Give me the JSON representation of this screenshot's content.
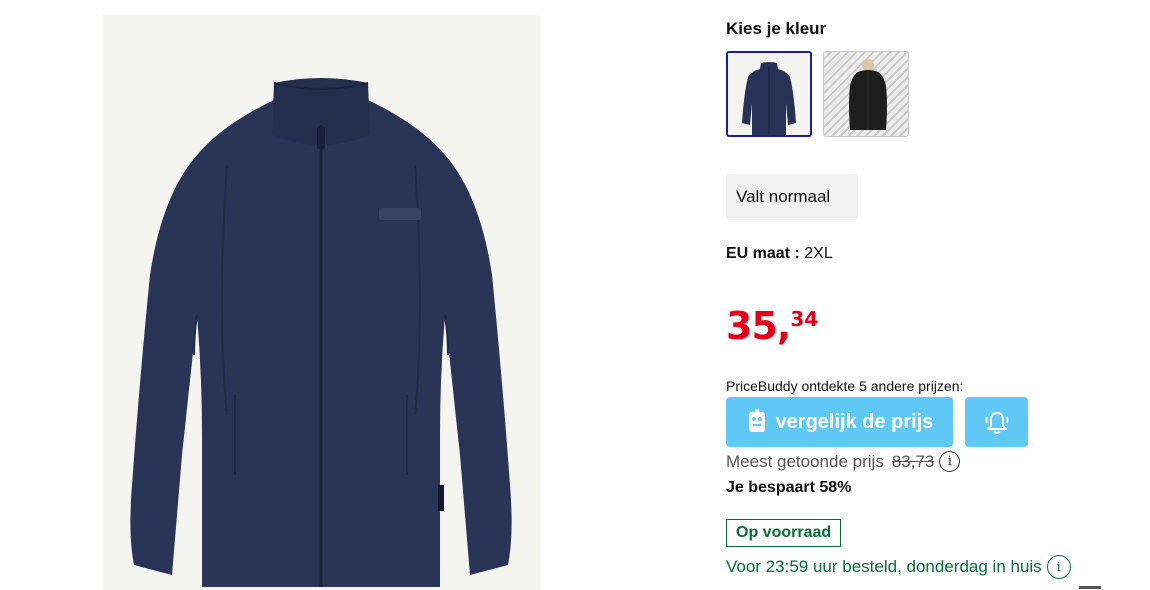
{
  "product": {
    "image_name": "navy fleece jacket"
  },
  "color_picker": {
    "title": "Kies je kleur",
    "options": [
      {
        "name": "navy",
        "color": "#283257",
        "selected": true
      },
      {
        "name": "black",
        "color": "#1e1e1e",
        "selected": false
      }
    ]
  },
  "fit": {
    "label": "Valt normaal"
  },
  "size": {
    "label": "EU maat :",
    "value": "2XL"
  },
  "price": {
    "euros": "35,",
    "cents": "34",
    "color": "#e0001b"
  },
  "pricebuddy": {
    "text": "PriceBuddy ontdekte 5 andere prijzen:",
    "compare_label": "vergelijk de prijs",
    "button_color": "#60c8f4",
    "alert_icon": "bell-icon"
  },
  "reference_price": {
    "label": "Meest getoonde prijs",
    "value": "83,73"
  },
  "savings": {
    "text": "Je bespaart 58%"
  },
  "stock": {
    "badge": "Op voorraad",
    "delivery": "Voor 23:59 uur besteld, donderdag in huis",
    "color": "#0b6b3a"
  }
}
